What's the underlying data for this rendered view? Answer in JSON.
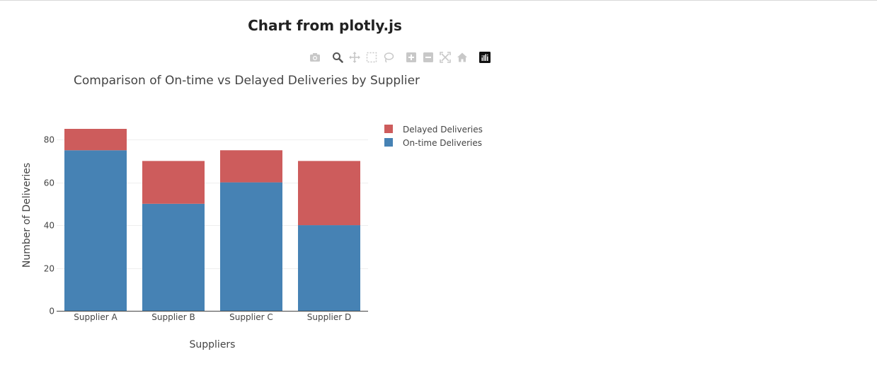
{
  "page": {
    "title": "Chart from plotly.js"
  },
  "modebar": {
    "buttons": [
      {
        "name": "camera-icon",
        "active": false
      },
      {
        "name": "zoom-icon",
        "active": true
      },
      {
        "name": "pan-icon",
        "active": false
      },
      {
        "name": "box-select-icon",
        "active": false
      },
      {
        "name": "lasso-select-icon",
        "active": false
      },
      {
        "name": "zoom-in-icon",
        "active": false
      },
      {
        "name": "zoom-out-icon",
        "active": false
      },
      {
        "name": "autoscale-icon",
        "active": false
      },
      {
        "name": "reset-axes-icon",
        "active": false
      },
      {
        "name": "plotly-logo-icon",
        "active": false
      }
    ]
  },
  "chart_data": {
    "type": "bar",
    "barmode": "stack",
    "title": "Comparison of On-time vs Delayed Deliveries by Supplier",
    "xlabel": "Suppliers",
    "ylabel": "Number of Deliveries",
    "categories": [
      "Supplier A",
      "Supplier B",
      "Supplier C",
      "Supplier D"
    ],
    "series": [
      {
        "name": "On-time Deliveries",
        "values": [
          75,
          50,
          60,
          40
        ],
        "color": "#4682b4"
      },
      {
        "name": "Delayed Deliveries",
        "values": [
          10,
          20,
          15,
          30
        ],
        "color": "#cd5c5c"
      }
    ],
    "ylim": [
      0,
      85
    ],
    "yticks": [
      0,
      20,
      40,
      60,
      80
    ],
    "grid": true,
    "legend": {
      "placement": "top-right",
      "order": [
        "Delayed Deliveries",
        "On-time Deliveries"
      ]
    }
  }
}
